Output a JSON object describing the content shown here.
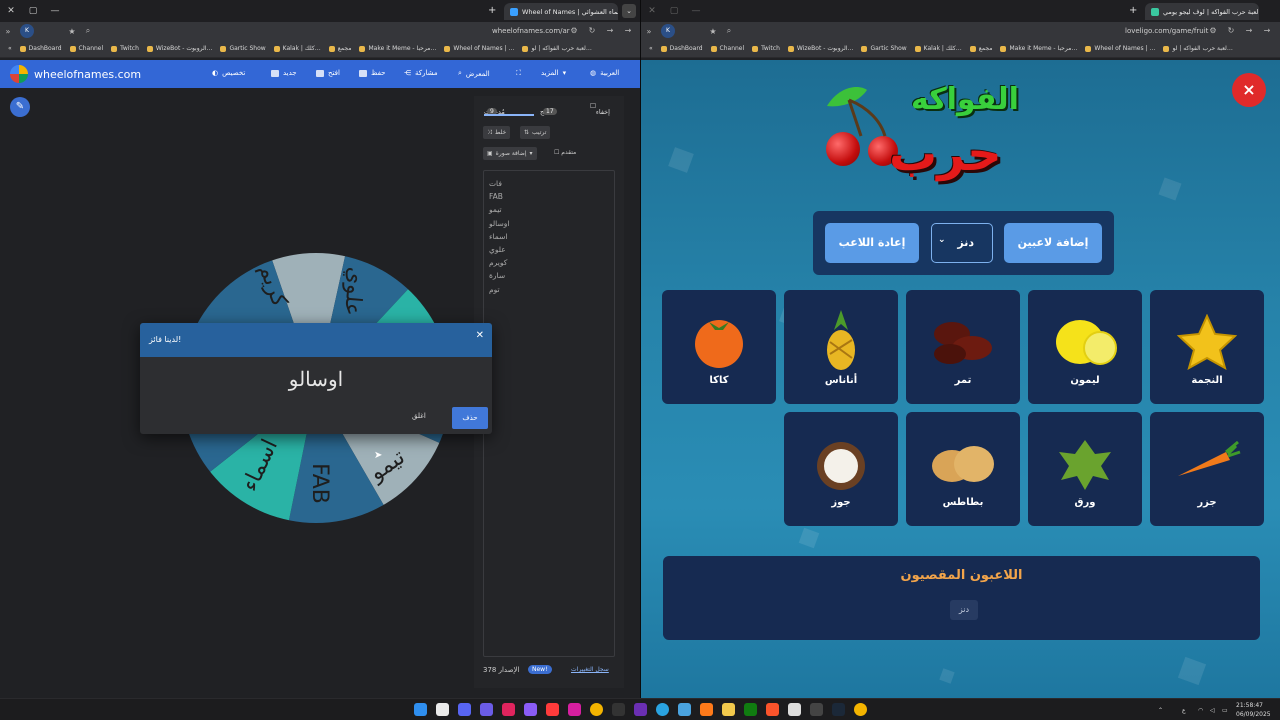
{
  "left_window": {
    "tab_title": "Wheel of Names | دولاب الأسماء العشوائي",
    "address": "wheelofnames.com/ar",
    "bookmarks": [
      "لعبة حرب الفواكه | لو…",
      "Wheel of Names | …",
      "Make it Meme - مرحبا…",
      "مجمع",
      "Kalak | كلك…",
      "Gartic Show",
      "WizeBot - الروبوت…",
      "Twitch",
      "Channel",
      "DashBoard"
    ],
    "app_title": "wheelofnames.com",
    "header_buttons": [
      "تخصيص",
      "جديد",
      "افتح",
      "حفظ",
      "مشاركة",
      "المعرض",
      "المزيد",
      "العربية"
    ],
    "panel_tabs": {
      "entries": "مُدخلات",
      "entries_count": "9",
      "results": "النتائج",
      "results_count": "17",
      "hide": "إخفاء"
    },
    "tools": {
      "shuffle": "خلط",
      "sort": "ترتيب",
      "add_image": "إضافة صورة",
      "advanced": "متقدم"
    },
    "entries": [
      "فات",
      "FAB",
      "تيمو",
      "اوسالو",
      "اسماء",
      "علوي",
      "كويرم",
      "سارة",
      "توم"
    ],
    "wheel_labels": [
      "كريم",
      "علوي",
      "تيمو",
      "FAB",
      "اسماء"
    ],
    "version_label": "الإصدار 378",
    "new_badge": "New!",
    "changelog_link": "سجل التغييرات",
    "dialog": {
      "title": "لدينا فائز!",
      "winner": "اوسالو",
      "keep_button": "حذف",
      "remove_button": "اغلق"
    }
  },
  "right_window": {
    "tab_title": "لعبة حرب الفواكه | لوف ليجو يومي",
    "address": "loveligo.com/game/fruit",
    "bookmarks": [
      "لعبة حرب الفواكه | لو…",
      "Wheel of Names | …",
      "Make it Meme - مرحبا…",
      "مجمع",
      "Kalak | كلك…",
      "Gartic Show",
      "WizeBot - الروبوت…",
      "Twitch",
      "Channel",
      "DashBoard"
    ],
    "logo_top": "الفواكه",
    "logo_bottom": "حرب",
    "add_players_button": "إضافة لاعبين",
    "player_select_value": "دنز",
    "reset_player_button": "إعادة اللاعب",
    "fruits_row1": [
      "النجمة",
      "ليمون",
      "تمر",
      "أناناس",
      "كاكا"
    ],
    "fruits_row2": [
      "جزر",
      "ورق",
      "بطاطس",
      "جوز"
    ],
    "eliminated_title": "اللاعبون المقصيون",
    "eliminated_players": [
      "دنز"
    ],
    "close_symbol": "×"
  },
  "taskbar": {
    "time": "21:58:47",
    "date": "06/09/2025",
    "lang": "ع"
  },
  "colors": {
    "won_header": "#3367d6",
    "dialog_header": "#27619d",
    "game_card": "#162a51",
    "button_blue": "#5a9be6",
    "accent_orange": "#f2a44a",
    "close_red": "#e02a2a"
  }
}
